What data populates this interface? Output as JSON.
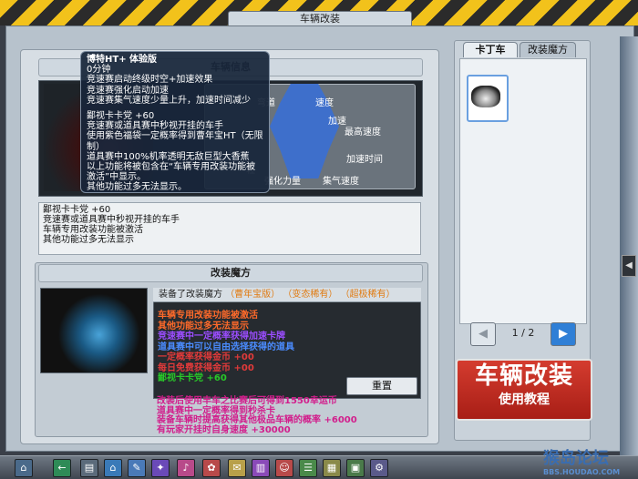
{
  "window": {
    "title": "车辆改装"
  },
  "car_info": {
    "header": "车辆信息",
    "stats": [
      "弯道",
      "速度",
      "加速",
      "最高速度",
      "加速时间",
      "强化力量",
      "集气速度",
      "轻"
    ],
    "perk_text": [
      "鄙视卡卡党 +60",
      "竞速赛或道具赛中秒视开挂的车手",
      "车辆专用改装功能被激活",
      "其他功能过多无法显示"
    ]
  },
  "tooltip": {
    "title": "博特HT+  体验版",
    "duration": "0分钟",
    "lines": [
      "竞速赛启动终级时空+加速效果",
      "竞速赛强化启动加速",
      "竞速赛集气速度少量上升，加速时间减少",
      "",
      "鄙视卡卡党 +60",
      "竞速赛或道具赛中秒视开挂的车手",
      "使用紫色福袋一定概率得到曹年宝HT（无限制）",
      "道具赛中100%机率透明无敌巨型大香蕉",
      "以上功能将被包含在“车辆专用改装功能被激活”中显示。",
      "其他功能过多无法显示。"
    ]
  },
  "modify": {
    "header": "改装魔方",
    "installed_label": "装备了改装魔方",
    "installed_tags": [
      "（曹年宝版）",
      "（变态稀有）",
      "（超极稀有）"
    ],
    "lines": [
      {
        "text": "车辆专用改装功能被激活",
        "color": "#ff6a2a"
      },
      {
        "text": "其他功能过多无法显示",
        "color": "#ff6a2a"
      },
      {
        "text": "竞速赛中一定概率获得加速卡牌",
        "color": "#9b4dff"
      },
      {
        "text": "道具赛中可以自由选择获得的道具",
        "color": "#4a8cff"
      },
      {
        "text": "一定概率获得金币 +00",
        "color": "#e23a3a"
      },
      {
        "text": "每日免费获得金币 +00",
        "color": "#e23a3a"
      },
      {
        "text": "鄙视卡卡党 +60",
        "color": "#28c828"
      },
      {
        "text": "",
        "color": "#28c828"
      }
    ],
    "reset_label": "重置",
    "bottom_lines": [
      {
        "text": "改装后使用丰车之比赛后可得到1550幸运币",
        "color": "#d21e8c"
      },
      {
        "text": "道具赛中一定概率得到秒杀卡",
        "color": "#d21e8c"
      },
      {
        "text": "装备车辆时提高获得其他极品车辆的概率 +6000",
        "color": "#d21e8c"
      },
      {
        "text": "有玩家开挂时自身速度 +30000",
        "color": "#d21e8c"
      }
    ]
  },
  "right_panel": {
    "tabs": [
      "卡丁车",
      "改装魔方"
    ],
    "page": "1 / 2",
    "prev_icon": "left-arrow-icon",
    "next_icon": "right-arrow-icon",
    "tutorial_line1": "车辆改装",
    "tutorial_line2": "使用教程"
  },
  "taskbar": {
    "icons": [
      "system-icon",
      "back-icon",
      "garage-icon",
      "home-icon",
      "tools-icon",
      "paint-icon",
      "music-icon",
      "gift-icon",
      "mail-icon",
      "book-icon",
      "friends-icon",
      "chat-icon",
      "stats-icon",
      "photo-icon",
      "settings-icon"
    ]
  },
  "watermark": {
    "line1": "猴岛论坛",
    "line2": "BBS.HOUDAO.COM"
  },
  "colors": {
    "accent": "#2f7fd6",
    "tutorial": "#c0291f",
    "hazard_yellow": "#f2c21b"
  }
}
